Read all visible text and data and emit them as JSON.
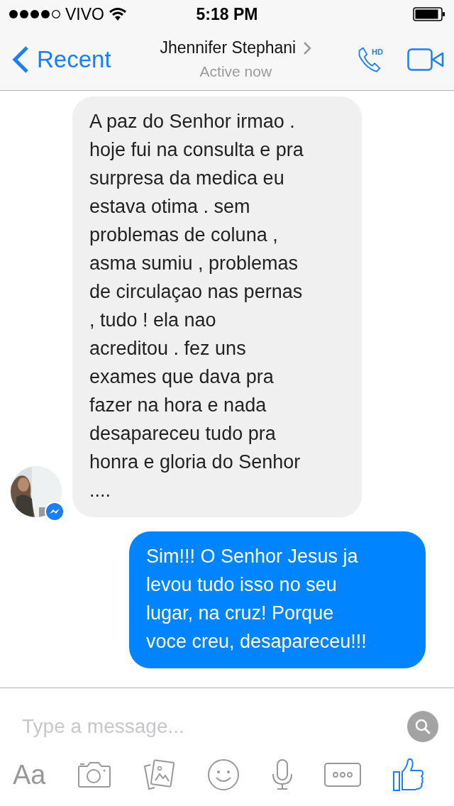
{
  "status_bar": {
    "carrier": "VIVO",
    "time": "5:18 PM"
  },
  "header": {
    "back_label": "Recent",
    "title": "Jhennifer Stephani",
    "subtitle": "Active now",
    "call_badge": "HD"
  },
  "messages": [
    {
      "kind": "received",
      "text": "A paz do Senhor irmao .\nhoje fui na consulta e pra\nsurpresa da medica eu\nestava otima . sem\nproblemas de coluna ,\nasma sumiu , problemas\nde circulaçao nas pernas\n, tudo  ! ela nao\nacreditou .  fez uns\nexames que dava pra\nfazer na hora e nada\ndesapareceu tudo pra\nhonra e gloria do Senhor\n...."
    },
    {
      "kind": "sent",
      "text": "Sim!!! O Senhor Jesus ja\nlevou tudo isso no seu\nlugar, na cruz! Porque\nvoce creu, desapareceu!!!"
    }
  ],
  "composer": {
    "placeholder": "Type a message...",
    "format_button": "Aa"
  }
}
